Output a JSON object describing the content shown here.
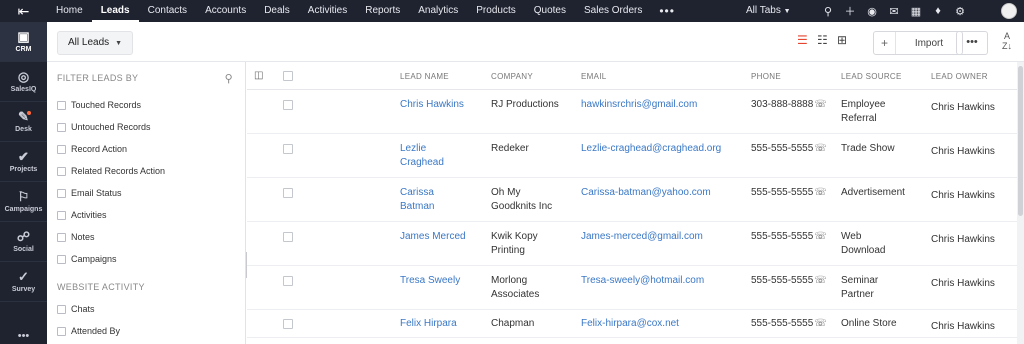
{
  "rail": {
    "items": [
      {
        "label": "CRM",
        "icon": "crm-icon"
      },
      {
        "label": "SalesIQ",
        "icon": "salesiq-icon"
      },
      {
        "label": "Desk",
        "icon": "desk-icon"
      },
      {
        "label": "Projects",
        "icon": "projects-icon"
      },
      {
        "label": "Campaigns",
        "icon": "campaigns-icon"
      },
      {
        "label": "Social",
        "icon": "social-icon"
      },
      {
        "label": "Survey",
        "icon": "survey-icon"
      }
    ]
  },
  "nav": {
    "tabs": [
      "Home",
      "Leads",
      "Contacts",
      "Accounts",
      "Deals",
      "Activities",
      "Reports",
      "Analytics",
      "Products",
      "Quotes",
      "Sales Orders"
    ],
    "active": "Leads",
    "all_tabs_label": "All Tabs"
  },
  "toolbar": {
    "view_label": "All Leads",
    "import_label": "Import"
  },
  "filters": {
    "heading": "FILTER LEADS BY",
    "items": [
      "Touched Records",
      "Untouched Records",
      "Record Action",
      "Related Records Action",
      "Email Status",
      "Activities",
      "Notes",
      "Campaigns"
    ],
    "section2_heading": "WEBSITE ACTIVITY",
    "section2_items": [
      "Chats",
      "Attended By"
    ]
  },
  "table": {
    "columns": [
      "LEAD NAME",
      "COMPANY",
      "EMAIL",
      "PHONE",
      "LEAD SOURCE",
      "LEAD OWNER"
    ],
    "rows": [
      {
        "name1": "Chris Hawkins",
        "name2": "",
        "company1": "RJ Productions",
        "company2": "",
        "email": "hawkinsrchris@gmail.com",
        "phone": "303-888-8888",
        "source1": "Employee",
        "source2": "Referral",
        "owner": "Chris Hawkins"
      },
      {
        "name1": "Lezlie",
        "name2": "Craghead",
        "company1": "Redeker",
        "company2": "",
        "email": "Lezlie-craghead@craghead.org",
        "phone": "555-555-5555",
        "source1": "Trade Show",
        "source2": "",
        "owner": "Chris Hawkins"
      },
      {
        "name1": "Carissa",
        "name2": "Batman",
        "company1": "Oh My",
        "company2": "Goodknits Inc",
        "email": "Carissa-batman@yahoo.com",
        "phone": "555-555-5555",
        "source1": "Advertisement",
        "source2": "",
        "owner": "Chris Hawkins"
      },
      {
        "name1": "James Merced",
        "name2": "",
        "company1": "Kwik Kopy",
        "company2": "Printing",
        "email": "James-merced@gmail.com",
        "phone": "555-555-5555",
        "source1": "Web",
        "source2": "Download",
        "owner": "Chris Hawkins"
      },
      {
        "name1": "Tresa Sweely",
        "name2": "",
        "company1": "Morlong",
        "company2": "Associates",
        "email": "Tresa-sweely@hotmail.com",
        "phone": "555-555-5555",
        "source1": "Seminar",
        "source2": "Partner",
        "owner": "Chris Hawkins"
      },
      {
        "name1": "Felix Hirpara",
        "name2": "",
        "company1": "Chapman",
        "company2": "",
        "email": "Felix-hirpara@cox.net",
        "phone": "555-555-5555",
        "source1": "Online Store",
        "source2": "",
        "owner": "Chris Hawkins"
      }
    ]
  },
  "colors": {
    "nav_bg": "#1f2330",
    "link": "#3a78c6",
    "accent": "#e5462f"
  }
}
